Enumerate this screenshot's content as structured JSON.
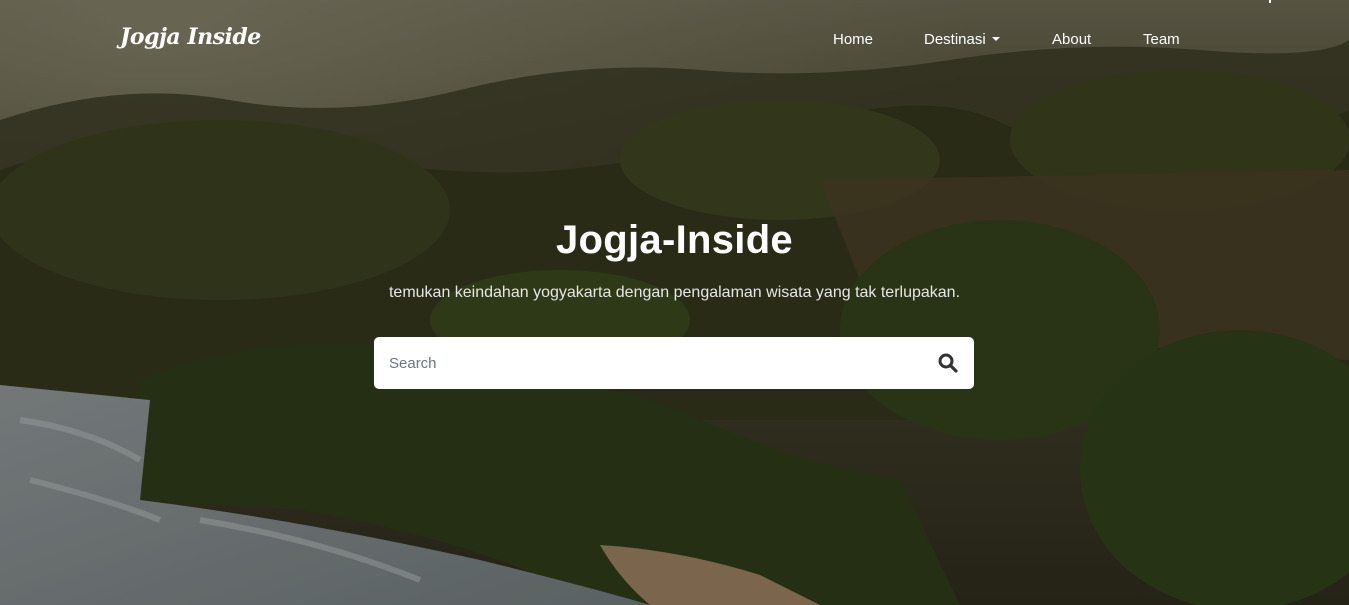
{
  "navbar": {
    "brand": "Jogja Inside",
    "links": [
      {
        "label": "Home"
      },
      {
        "label": "Destinasi"
      },
      {
        "label": "About"
      },
      {
        "label": "Team"
      }
    ]
  },
  "hero": {
    "title": "Jogja-Inside",
    "subtitle": "temukan keindahan yogyakarta dengan pengalaman wisata yang tak terlupakan.",
    "background": "aerial view of green forested hills and a beach with surf"
  },
  "search": {
    "placeholder": "Search",
    "value": "",
    "icon": "search-icon"
  },
  "colors": {
    "text": "#ffffff",
    "search_bg": "#ffffff",
    "icon": "#333333"
  }
}
